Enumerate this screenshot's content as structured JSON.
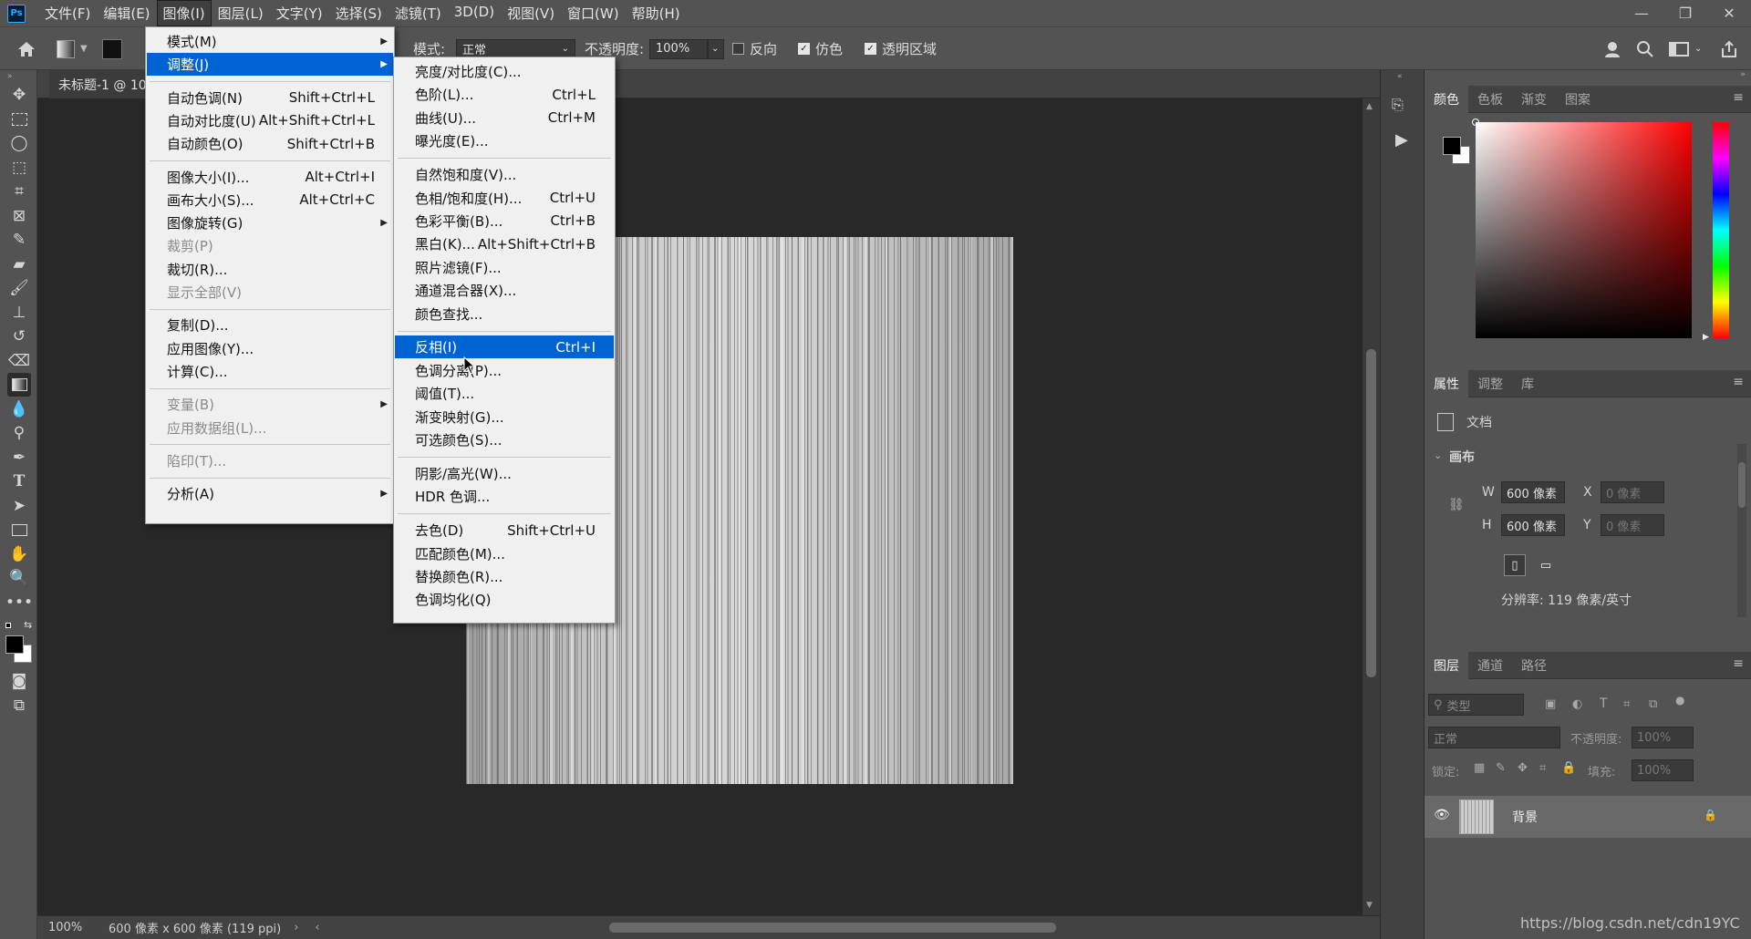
{
  "app": {
    "logo": "Ps"
  },
  "menubar": {
    "items": [
      "文件(F)",
      "编辑(E)",
      "图像(I)",
      "图层(L)",
      "文字(Y)",
      "选择(S)",
      "滤镜(T)",
      "3D(D)",
      "视图(V)",
      "窗口(W)",
      "帮助(H)"
    ],
    "active_index": 2
  },
  "window_controls": {
    "minimize": "—",
    "restore": "❐",
    "close": "✕"
  },
  "options": {
    "mode_label": "模式:",
    "mode_value": "正常",
    "opacity_label": "不透明度:",
    "opacity_value": "100%",
    "reverse_label": "反向",
    "reverse_checked": false,
    "dither_label": "仿色",
    "dither_checked": true,
    "transparency_label": "透明区域",
    "transparency_checked": true
  },
  "document": {
    "tab_title": "未标题-1 @ 10",
    "status_zoom": "100%",
    "status_info": "600 像素 x 600 像素 (119 ppi)"
  },
  "image_menu": [
    {
      "label": "模式(M)",
      "shortcut": "",
      "submenu": true,
      "disabled": false
    },
    {
      "label": "调整(J)",
      "shortcut": "",
      "submenu": true,
      "disabled": false,
      "highlighted": true
    },
    {
      "sep": true
    },
    {
      "label": "自动色调(N)",
      "shortcut": "Shift+Ctrl+L"
    },
    {
      "label": "自动对比度(U)",
      "shortcut": "Alt+Shift+Ctrl+L"
    },
    {
      "label": "自动颜色(O)",
      "shortcut": "Shift+Ctrl+B"
    },
    {
      "sep": true
    },
    {
      "label": "图像大小(I)...",
      "shortcut": "Alt+Ctrl+I"
    },
    {
      "label": "画布大小(S)...",
      "shortcut": "Alt+Ctrl+C"
    },
    {
      "label": "图像旋转(G)",
      "shortcut": "",
      "submenu": true
    },
    {
      "label": "裁剪(P)",
      "shortcut": "",
      "disabled": true
    },
    {
      "label": "裁切(R)...",
      "shortcut": ""
    },
    {
      "label": "显示全部(V)",
      "shortcut": "",
      "disabled": true
    },
    {
      "sep": true
    },
    {
      "label": "复制(D)...",
      "shortcut": ""
    },
    {
      "label": "应用图像(Y)...",
      "shortcut": ""
    },
    {
      "label": "计算(C)...",
      "shortcut": ""
    },
    {
      "sep": true
    },
    {
      "label": "变量(B)",
      "shortcut": "",
      "submenu": true,
      "disabled": true
    },
    {
      "label": "应用数据组(L)...",
      "shortcut": "",
      "disabled": true
    },
    {
      "sep": true
    },
    {
      "label": "陷印(T)...",
      "shortcut": "",
      "disabled": true
    },
    {
      "sep": true
    },
    {
      "label": "分析(A)",
      "shortcut": "",
      "submenu": true
    }
  ],
  "adjust_menu": [
    {
      "label": "亮度/对比度(C)...",
      "shortcut": ""
    },
    {
      "label": "色阶(L)...",
      "shortcut": "Ctrl+L"
    },
    {
      "label": "曲线(U)...",
      "shortcut": "Ctrl+M"
    },
    {
      "label": "曝光度(E)...",
      "shortcut": ""
    },
    {
      "sep": true
    },
    {
      "label": "自然饱和度(V)...",
      "shortcut": ""
    },
    {
      "label": "色相/饱和度(H)...",
      "shortcut": "Ctrl+U"
    },
    {
      "label": "色彩平衡(B)...",
      "shortcut": "Ctrl+B"
    },
    {
      "label": "黑白(K)...",
      "shortcut": "Alt+Shift+Ctrl+B"
    },
    {
      "label": "照片滤镜(F)...",
      "shortcut": ""
    },
    {
      "label": "通道混合器(X)...",
      "shortcut": ""
    },
    {
      "label": "颜色查找...",
      "shortcut": ""
    },
    {
      "sep": true
    },
    {
      "label": "反相(I)",
      "shortcut": "Ctrl+I",
      "highlighted": true
    },
    {
      "label": "色调分离(P)...",
      "shortcut": ""
    },
    {
      "label": "阈值(T)...",
      "shortcut": ""
    },
    {
      "label": "渐变映射(G)...",
      "shortcut": ""
    },
    {
      "label": "可选颜色(S)...",
      "shortcut": ""
    },
    {
      "sep": true
    },
    {
      "label": "阴影/高光(W)...",
      "shortcut": ""
    },
    {
      "label": "HDR 色调...",
      "shortcut": ""
    },
    {
      "sep": true
    },
    {
      "label": "去色(D)",
      "shortcut": "Shift+Ctrl+U"
    },
    {
      "label": "匹配颜色(M)...",
      "shortcut": ""
    },
    {
      "label": "替换颜色(R)...",
      "shortcut": ""
    },
    {
      "label": "色调均化(Q)",
      "shortcut": ""
    }
  ],
  "color_panel": {
    "tabs": [
      "颜色",
      "色板",
      "渐变",
      "图案"
    ],
    "active_tab": 0
  },
  "properties_panel": {
    "tabs": [
      "属性",
      "调整",
      "库"
    ],
    "active_tab": 0,
    "doc_label": "文档",
    "canvas_label": "画布",
    "w_label": "W",
    "w_value": "600 像素",
    "h_label": "H",
    "h_value": "600 像素",
    "x_label": "X",
    "x_value": "0 像素",
    "y_label": "Y",
    "y_value": "0 像素",
    "resolution": "分辨率: 119 像素/英寸"
  },
  "layers_panel": {
    "tabs": [
      "图层",
      "通道",
      "路径"
    ],
    "active_tab": 0,
    "filter_placeholder": "类型",
    "blend_mode": "正常",
    "opacity_label": "不透明度:",
    "opacity_value": "100%",
    "lock_label": "锁定:",
    "fill_label": "填充:",
    "fill_value": "100%",
    "layers": [
      {
        "name": "背景",
        "visible": true,
        "locked": true
      }
    ]
  },
  "watermark": "https://blog.csdn.net/cdn19YC"
}
